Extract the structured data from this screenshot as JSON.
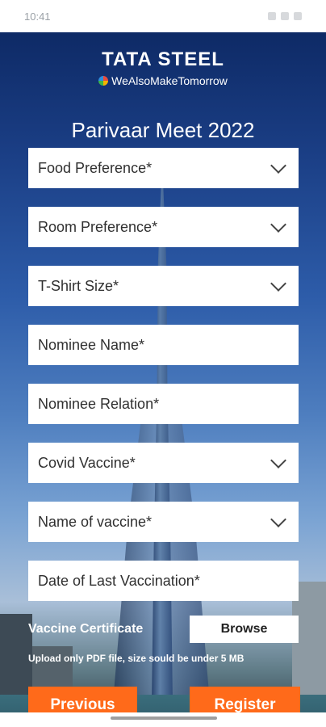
{
  "statusbar": {
    "time": "10:41"
  },
  "logo": {
    "main": "TATA STEEL",
    "tagline": "WeAlsoMakeTomorrow"
  },
  "page_title": "Parivaar Meet 2022",
  "fields": {
    "food": "Food Preference*",
    "room": "Room Preference*",
    "tshirt": "T-Shirt Size*",
    "nominee_name": "Nominee Name*",
    "nominee_relation": "Nominee Relation*",
    "covid_vaccine": "Covid Vaccine*",
    "vaccine_name": "Name of vaccine*",
    "last_vaccination": "Date of Last Vaccination*"
  },
  "certificate": {
    "label": "Vaccine Certificate",
    "browse": "Browse",
    "hint": "Upload only PDF file, size sould be under 5 MB"
  },
  "actions": {
    "previous": "Previous",
    "register": "Register"
  },
  "colors": {
    "accent": "#ff6a1a"
  }
}
